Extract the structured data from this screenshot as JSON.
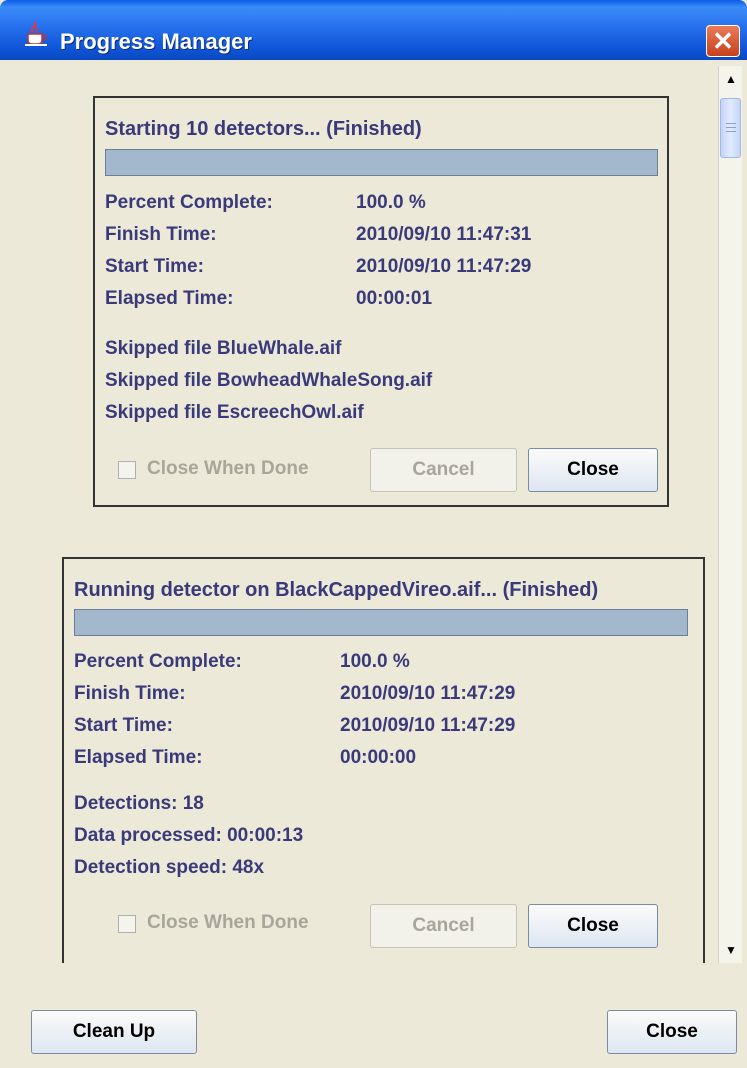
{
  "window": {
    "title": "Progress Manager",
    "icon": "java-coffee-cup-icon"
  },
  "scrollbar": {
    "up_glyph": "▲",
    "down_glyph": "▼"
  },
  "tasks": [
    {
      "title": "Starting 10 detectors... (Finished)",
      "progress": 1.0,
      "fields": [
        {
          "label": "Percent Complete:",
          "value": "100.0 %"
        },
        {
          "label": "Finish Time:",
          "value": "2010/09/10 11:47:31"
        },
        {
          "label": "Start Time:",
          "value": "2010/09/10 11:47:29"
        },
        {
          "label": "Elapsed Time:",
          "value": "00:00:01"
        }
      ],
      "messages": [
        "Skipped file BlueWhale.aif",
        "Skipped file BowheadWhaleSong.aif",
        "Skipped file EscreechOwl.aif"
      ],
      "close_when_done_label": "Close When Done",
      "close_when_done_checked": false,
      "cancel_label": "Cancel",
      "close_label": "Close"
    },
    {
      "title": "Running detector on BlackCappedVireo.aif... (Finished)",
      "progress": 1.0,
      "fields": [
        {
          "label": "Percent Complete:",
          "value": "100.0 %"
        },
        {
          "label": "Finish Time:",
          "value": "2010/09/10 11:47:29"
        },
        {
          "label": "Start Time:",
          "value": "2010/09/10 11:47:29"
        },
        {
          "label": "Elapsed Time:",
          "value": "00:00:00"
        }
      ],
      "messages": [
        "Detections: 18",
        "Data processed: 00:00:13",
        "Detection speed: 48x"
      ],
      "close_when_done_label": "Close When Done",
      "close_when_done_checked": false,
      "cancel_label": "Cancel",
      "close_label": "Close"
    }
  ],
  "footer": {
    "clean_up_label": "Clean Up",
    "close_label": "Close"
  },
  "colors": {
    "accent_text": "#3a3a7a",
    "progress_fill": "#a3b8cc",
    "title_bar": "#0a5ce9"
  }
}
